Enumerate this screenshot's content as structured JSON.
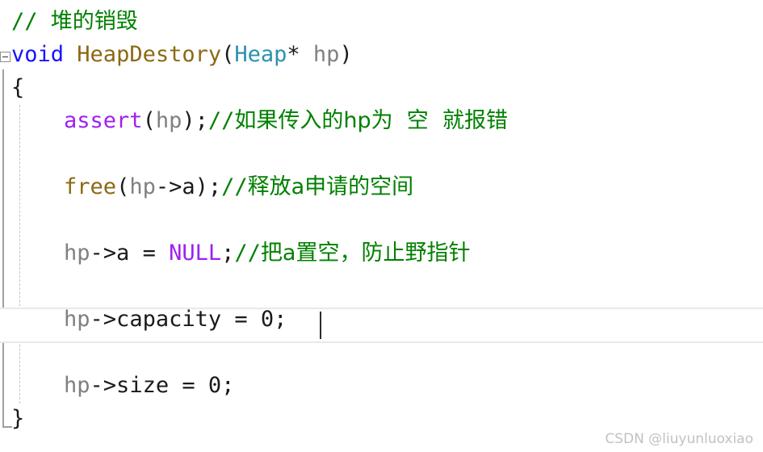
{
  "editor": {
    "filetype": "c",
    "theme": "light",
    "font_size_px": 27,
    "colors": {
      "background": "#ffffff",
      "foreground": "#1a1a1a",
      "comment": "#008000",
      "keyword": "#1414ff",
      "function": "#8b6914",
      "type": "#2b91af",
      "variable": "#808080",
      "macro": "#a020f0",
      "current_line_border": "#e8e8f2",
      "fold_bar": "#a0a0a0",
      "indent_guide": "#c6c6c6",
      "caret": "#2b2b2b",
      "watermark": "#c2c2c2"
    },
    "fold_marker": "collapse-minus",
    "current_line_index": 9
  },
  "code": {
    "lines": [
      {
        "id": "line-1",
        "indent": "",
        "tokens": [
          {
            "kind": "comment",
            "text": "// ",
            "cjk": false
          },
          {
            "kind": "comment",
            "text": "堆的销毁",
            "cjk": true
          }
        ]
      },
      {
        "id": "line-2",
        "indent": "",
        "tokens": [
          {
            "kind": "keyword",
            "text": "void",
            "cjk": false
          },
          {
            "kind": "plain",
            "text": " ",
            "cjk": false
          },
          {
            "kind": "func",
            "text": "HeapDestory",
            "cjk": false
          },
          {
            "kind": "plain",
            "text": "(",
            "cjk": false
          },
          {
            "kind": "type",
            "text": "Heap",
            "cjk": false
          },
          {
            "kind": "plain",
            "text": "* ",
            "cjk": false
          },
          {
            "kind": "var",
            "text": "hp",
            "cjk": false
          },
          {
            "kind": "plain",
            "text": ")",
            "cjk": false
          }
        ]
      },
      {
        "id": "line-3",
        "indent": "",
        "tokens": [
          {
            "kind": "plain",
            "text": "{",
            "cjk": false
          }
        ]
      },
      {
        "id": "line-4",
        "indent": "    ",
        "tokens": [
          {
            "kind": "macro",
            "text": "assert",
            "cjk": false
          },
          {
            "kind": "plain",
            "text": "(",
            "cjk": false
          },
          {
            "kind": "var",
            "text": "hp",
            "cjk": false
          },
          {
            "kind": "plain",
            "text": ");",
            "cjk": false
          },
          {
            "kind": "comment",
            "text": "//",
            "cjk": false
          },
          {
            "kind": "comment",
            "text": "如果传入的hp为  空  就报错",
            "cjk": true
          }
        ]
      },
      {
        "id": "line-5",
        "indent": "",
        "tokens": []
      },
      {
        "id": "line-6",
        "indent": "    ",
        "tokens": [
          {
            "kind": "func",
            "text": "free",
            "cjk": false
          },
          {
            "kind": "plain",
            "text": "(",
            "cjk": false
          },
          {
            "kind": "var",
            "text": "hp",
            "cjk": false
          },
          {
            "kind": "plain",
            "text": "->a);",
            "cjk": false
          },
          {
            "kind": "comment",
            "text": "//",
            "cjk": false
          },
          {
            "kind": "comment",
            "text": "释放a申请的空间",
            "cjk": true
          }
        ]
      },
      {
        "id": "line-7",
        "indent": "",
        "tokens": []
      },
      {
        "id": "line-8",
        "indent": "    ",
        "tokens": [
          {
            "kind": "var",
            "text": "hp",
            "cjk": false
          },
          {
            "kind": "plain",
            "text": "->a = ",
            "cjk": false
          },
          {
            "kind": "macro",
            "text": "NULL",
            "cjk": false
          },
          {
            "kind": "plain",
            "text": ";",
            "cjk": false
          },
          {
            "kind": "comment",
            "text": "//",
            "cjk": false
          },
          {
            "kind": "comment",
            "text": "把a置空，防止野指针",
            "cjk": true
          }
        ]
      },
      {
        "id": "line-9",
        "indent": "",
        "tokens": []
      },
      {
        "id": "line-10",
        "indent": "    ",
        "tokens": [
          {
            "kind": "var",
            "text": "hp",
            "cjk": false
          },
          {
            "kind": "plain",
            "text": "->capacity = ",
            "cjk": false
          },
          {
            "kind": "num",
            "text": "0",
            "cjk": false
          },
          {
            "kind": "plain",
            "text": ";",
            "cjk": false
          }
        ]
      },
      {
        "id": "line-11",
        "indent": "",
        "tokens": []
      },
      {
        "id": "line-12",
        "indent": "    ",
        "tokens": [
          {
            "kind": "var",
            "text": "hp",
            "cjk": false
          },
          {
            "kind": "plain",
            "text": "->size = ",
            "cjk": false
          },
          {
            "kind": "num",
            "text": "0",
            "cjk": false
          },
          {
            "kind": "plain",
            "text": ";",
            "cjk": false
          }
        ]
      },
      {
        "id": "line-13",
        "indent": "",
        "tokens": [
          {
            "kind": "plain",
            "text": "}",
            "cjk": false
          }
        ]
      }
    ]
  },
  "watermark": {
    "text": "CSDN @liuyunluoxiao"
  }
}
